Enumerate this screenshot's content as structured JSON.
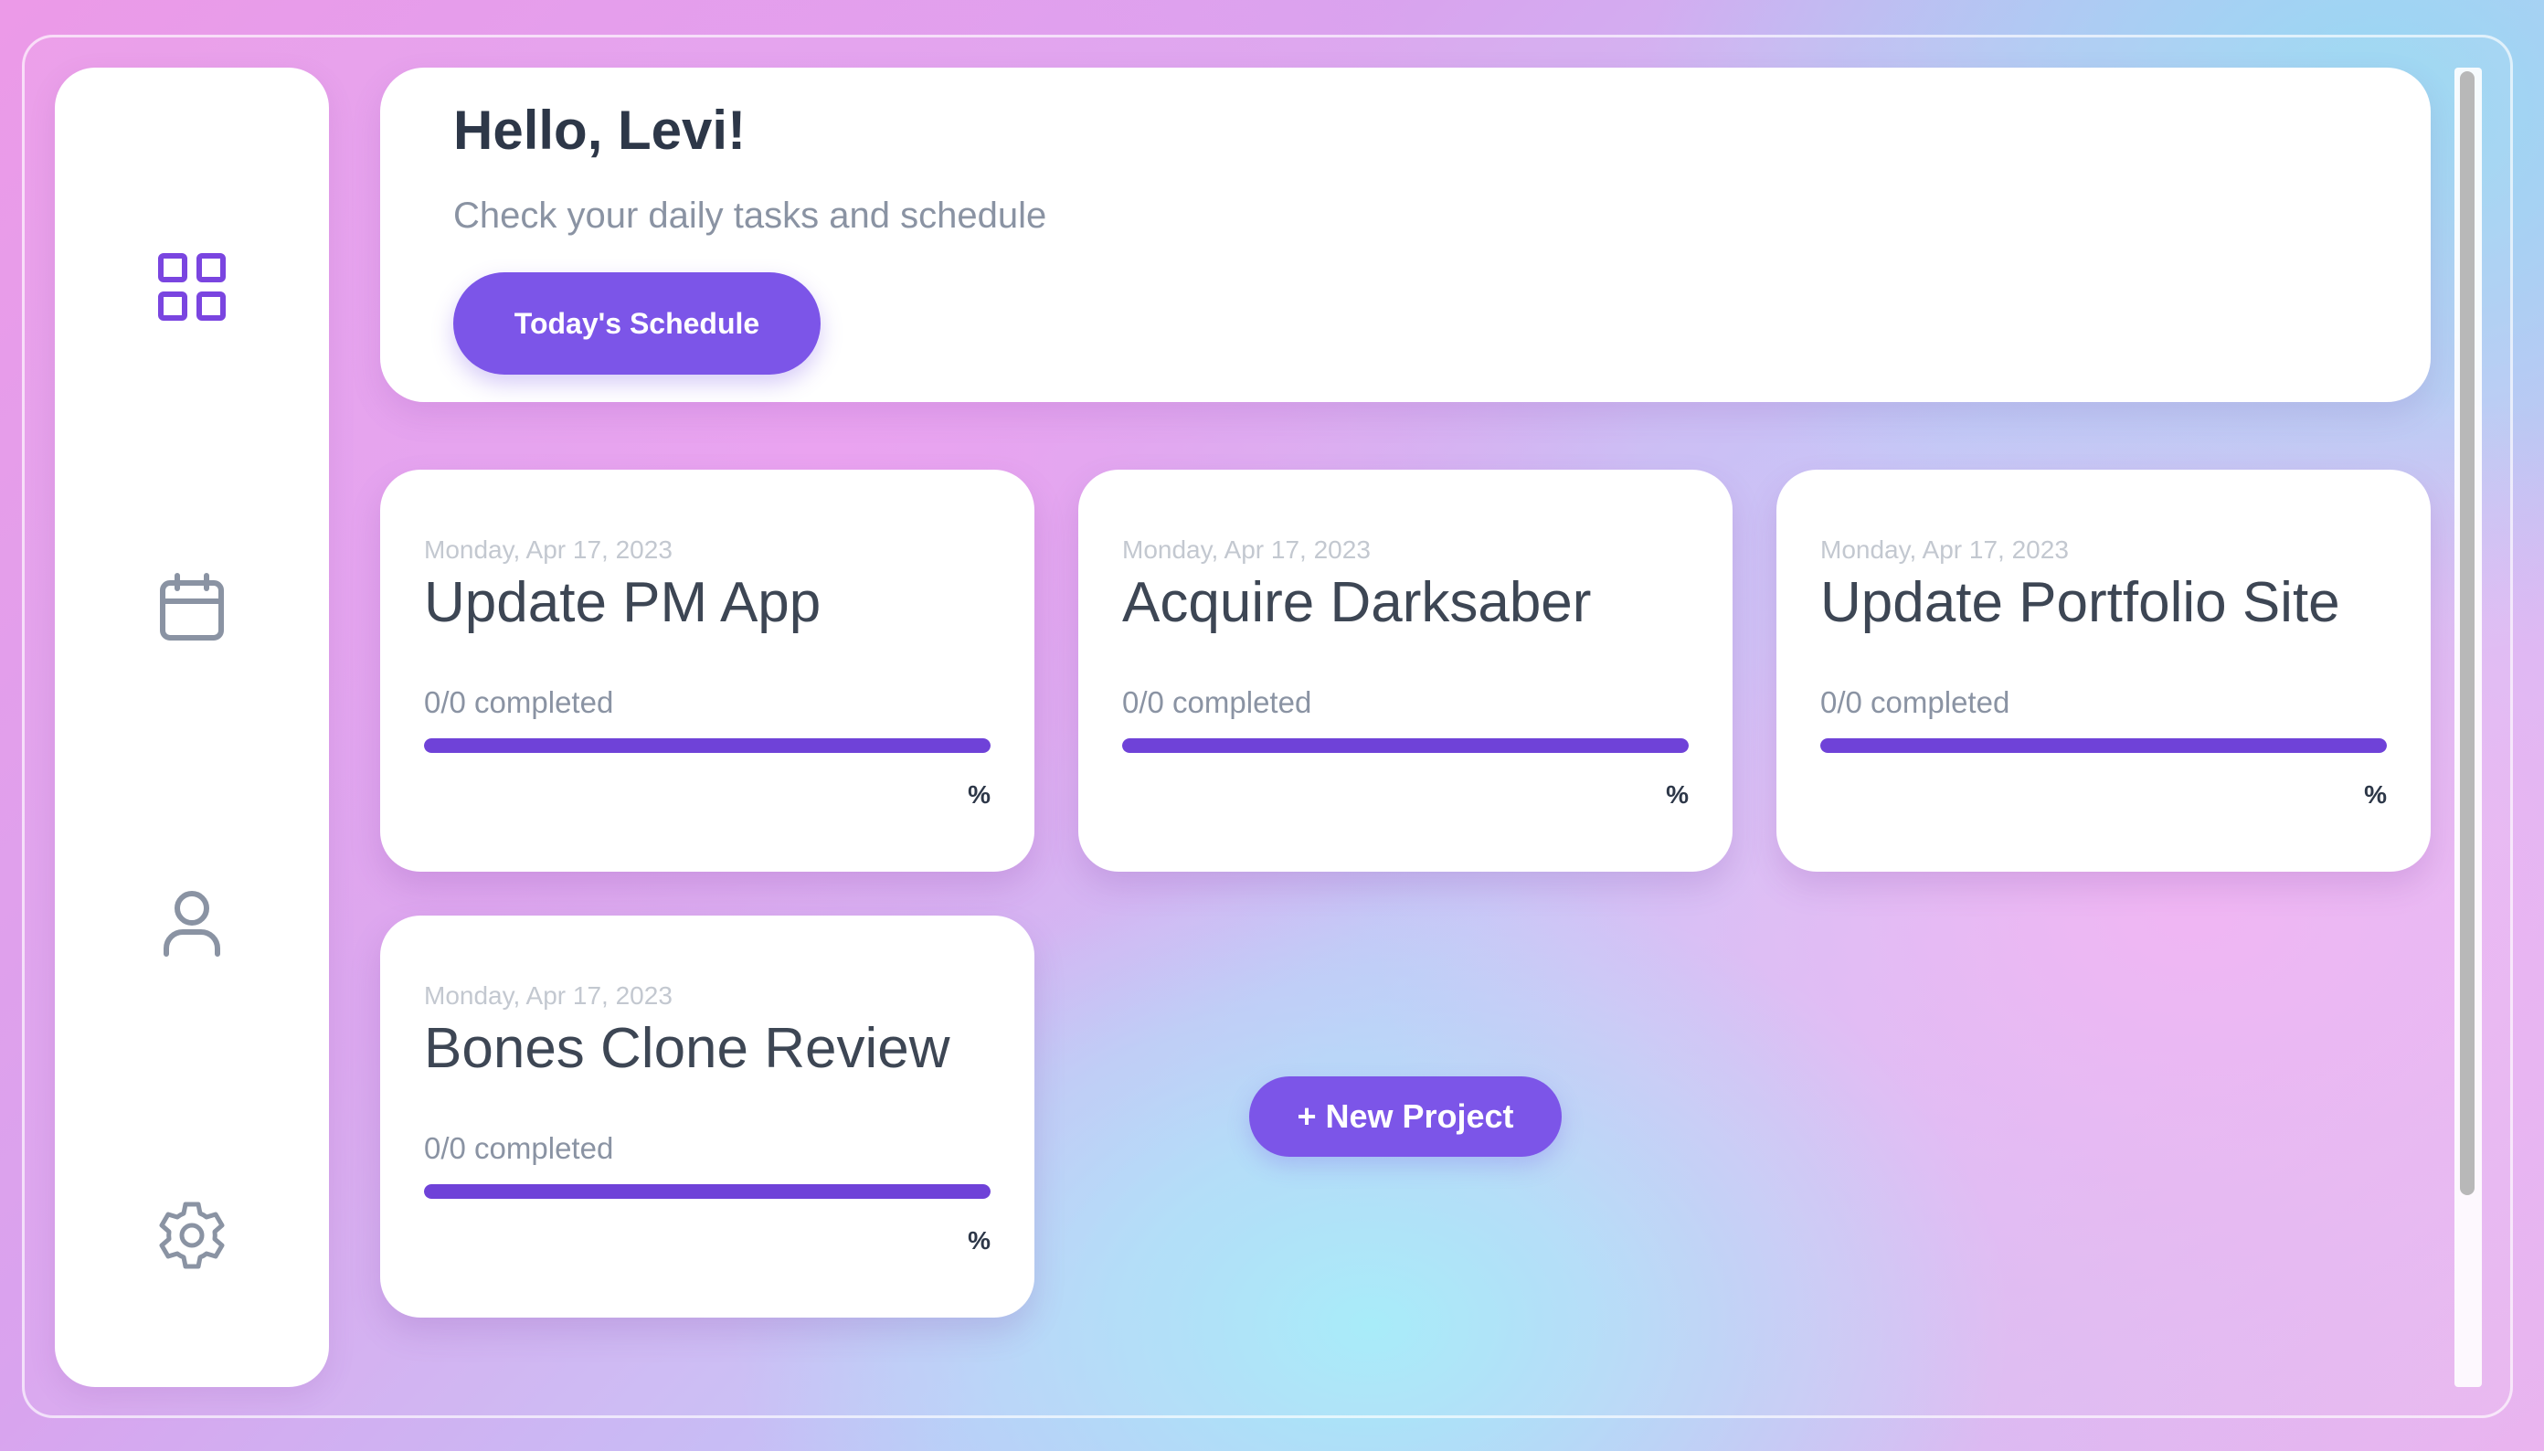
{
  "sidebar": {
    "items": [
      {
        "icon": "grid-icon",
        "active": true
      },
      {
        "icon": "calendar-icon",
        "active": false
      },
      {
        "icon": "user-icon",
        "active": false
      },
      {
        "icon": "gear-icon",
        "active": false
      }
    ]
  },
  "header": {
    "greeting": "Hello, Levi!",
    "subtitle": "Check your daily tasks and schedule",
    "schedule_button": "Today's Schedule"
  },
  "projects": [
    {
      "date": "Monday, Apr 17, 2023",
      "title": "Update PM App",
      "completed": "0/0 completed",
      "percent_label": "%",
      "progress": 1.0
    },
    {
      "date": "Monday, Apr 17, 2023",
      "title": "Acquire Darksaber",
      "completed": "0/0 completed",
      "percent_label": "%",
      "progress": 1.0
    },
    {
      "date": "Monday, Apr 17, 2023",
      "title": "Update Portfolio Site",
      "completed": "0/0 completed",
      "percent_label": "%",
      "progress": 1.0
    },
    {
      "date": "Monday, Apr 17, 2023",
      "title": "Bones Clone Review",
      "completed": "0/0 completed",
      "percent_label": "%",
      "progress": 1.0
    }
  ],
  "new_project_button": "+ New Project",
  "colors": {
    "accent": "#7c55e8",
    "progress": "#6f42d8",
    "icon_active": "#7a45e0",
    "icon_inactive": "#8a93a3"
  }
}
